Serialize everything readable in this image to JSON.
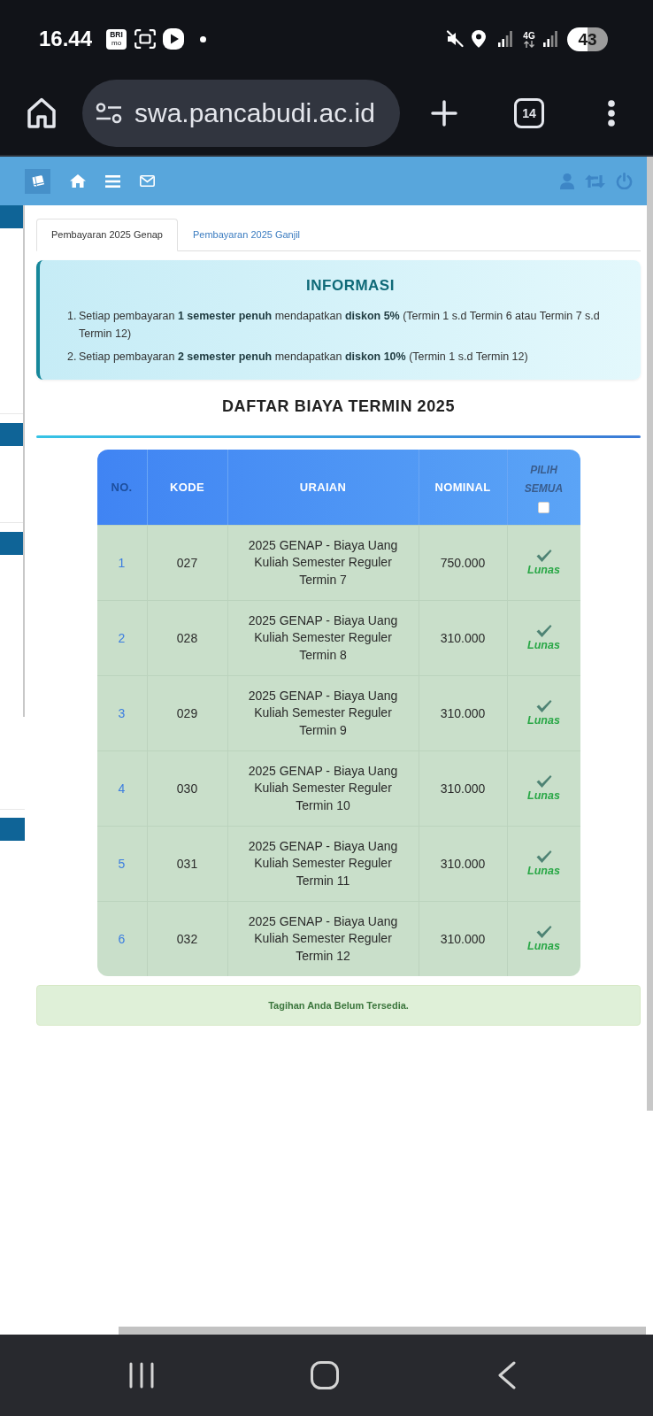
{
  "status_bar": {
    "time": "16.44",
    "app_logo": {
      "top": "BRI",
      "bottom": "mo"
    },
    "network": "4G",
    "battery": "43"
  },
  "browser": {
    "url": "swa.pancabudi.ac.id",
    "tab_count": "14"
  },
  "app_header": {
    "left_icons": [
      {
        "kind": "book",
        "selected": true
      },
      {
        "kind": "home",
        "selected": false
      },
      {
        "kind": "menu",
        "selected": false
      },
      {
        "kind": "mail",
        "selected": false
      }
    ],
    "right_icons": [
      {
        "kind": "user"
      },
      {
        "kind": "swap"
      },
      {
        "kind": "power"
      }
    ]
  },
  "tabs": [
    {
      "label": "Pembayaran 2025 Genap",
      "selected": true
    },
    {
      "label": "Pembayaran 2025 Ganjil",
      "selected": false
    }
  ],
  "info": {
    "title": "INFORMASI",
    "items": [
      {
        "number": "1.",
        "text": "Setiap pembayaran **1 semester penuh** mendapatkan **diskon 5%** (Termin 1 s.d Termin 6 atau Termin 7 s.d Termin 12)"
      },
      {
        "number": "2.",
        "text": "Setiap pembayaran **2 semester penuh** mendapatkan **diskon 10%** (Termin 1 s.d Termin 12)"
      }
    ]
  },
  "heading": "DAFTAR BIAYA TERMIN 2025",
  "table": {
    "columns": [
      "NO.",
      "KODE",
      "URAIAN",
      "NOMINAL",
      "PILIH SEMUA"
    ],
    "select_all": {
      "checked": false
    },
    "rows": [
      {
        "no": "1",
        "kode": "027",
        "uraian": "2025 GENAP - Biaya Uang Kuliah Semester Reguler Termin 7",
        "nominal": "750.000",
        "paid": true,
        "status": "Lunas"
      },
      {
        "no": "2",
        "kode": "028",
        "uraian": "2025 GENAP - Biaya Uang Kuliah Semester Reguler Termin 8",
        "nominal": "310.000",
        "paid": true,
        "status": "Lunas"
      },
      {
        "no": "3",
        "kode": "029",
        "uraian": "2025 GENAP - Biaya Uang Kuliah Semester Reguler Termin 9",
        "nominal": "310.000",
        "paid": true,
        "status": "Lunas"
      },
      {
        "no": "4",
        "kode": "030",
        "uraian": "2025 GENAP - Biaya Uang Kuliah Semester Reguler Termin 10",
        "nominal": "310.000",
        "paid": true,
        "status": "Lunas"
      },
      {
        "no": "5",
        "kode": "031",
        "uraian": "2025 GENAP - Biaya Uang Kuliah Semester Reguler Termin 11",
        "nominal": "310.000",
        "paid": true,
        "status": "Lunas"
      },
      {
        "no": "6",
        "kode": "032",
        "uraian": "2025 GENAP - Biaya Uang Kuliah Semester Reguler Termin 12",
        "nominal": "310.000",
        "paid": true,
        "status": "Lunas"
      }
    ]
  },
  "alert": "Tagihan Anda Belum Tersedia."
}
